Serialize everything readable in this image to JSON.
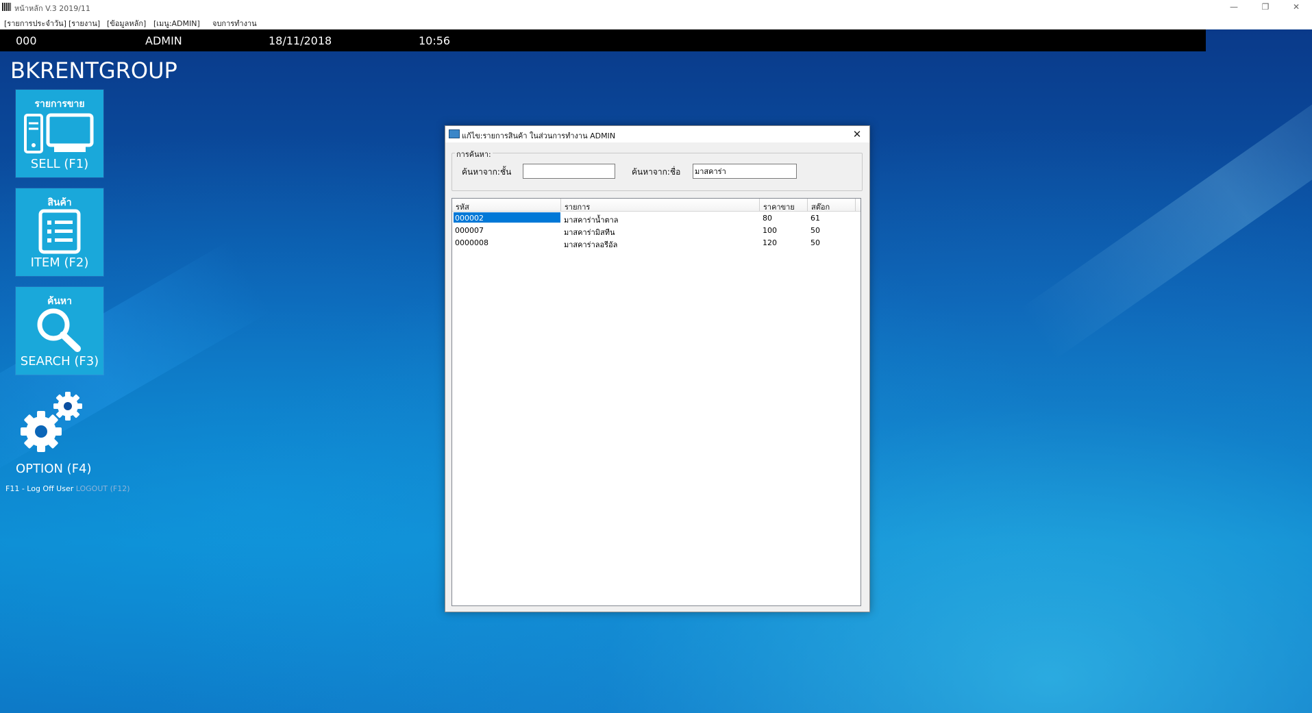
{
  "window": {
    "title": "หน้าหลัก V.3 2019/11",
    "minimize": "—",
    "restore": "❐",
    "close": "✕"
  },
  "menu": {
    "items": [
      "[รายการประจำวัน]",
      "[รายงาน]",
      "[ข้อมูลหลัก]",
      "[เมนู:ADMIN]",
      "จบการทำงาน"
    ]
  },
  "status": {
    "code": "000",
    "user": "ADMIN",
    "date": "18/11/2018",
    "time": "10:56"
  },
  "brand": "BKRENTGROUP",
  "tiles": [
    {
      "head": "รายการขาย",
      "label": "SELL (F1)",
      "icon": "computer-icon"
    },
    {
      "head": "สินค้า",
      "label": "ITEM (F2)",
      "icon": "list-icon"
    },
    {
      "head": "ค้นหา",
      "label": "SEARCH (F3)",
      "icon": "search-icon"
    }
  ],
  "option": {
    "label": "OPTION (F4)",
    "icon": "gear-icon"
  },
  "logoff": {
    "text": "F11 - Log Off User",
    "logout": "LOGOUT (F12)"
  },
  "dialog": {
    "title": "แก้ไข:รายการสินค้า ในส่วนการทำงาน ADMIN",
    "close": "✕",
    "search_group": "การค้นหา:",
    "search_code_label": "ค้นหาจาก:ชั้น",
    "search_code_value": "",
    "search_name_label": "ค้นหาจาก:ชื่อ",
    "search_name_value": "มาสคาร่า",
    "columns": [
      "รหัส",
      "รายการ",
      "ราคาขาย",
      "สต๊อก"
    ],
    "rows": [
      {
        "code": "000002",
        "name": "มาสคาร่าน้ำตาล",
        "price": "80",
        "stock": "61"
      },
      {
        "code": "000007",
        "name": "มาสคาร่ามิสทีน",
        "price": "100",
        "stock": "50"
      },
      {
        "code": "0000008",
        "name": "มาสคาร่าลอรีอัล",
        "price": "120",
        "stock": "50"
      }
    ]
  },
  "colors": {
    "tile": "#1aa8da",
    "status_bar": "#000000",
    "selection": "#0078d7"
  }
}
